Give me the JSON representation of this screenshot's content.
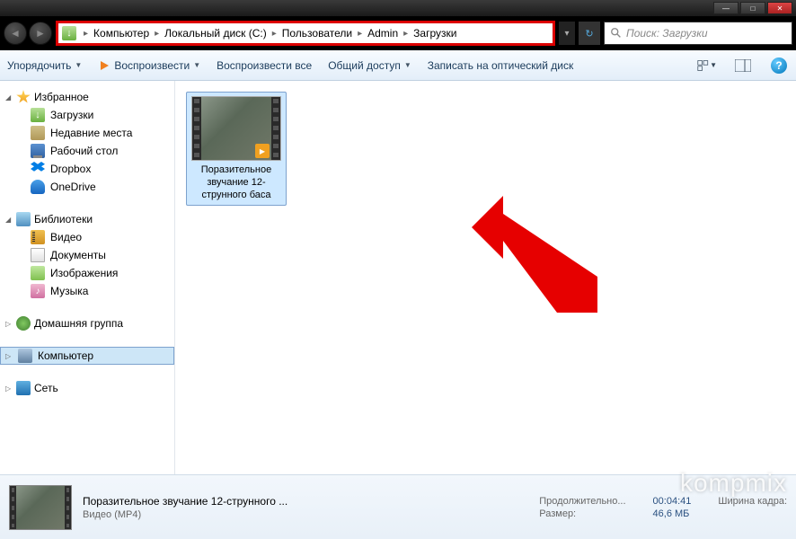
{
  "window": {
    "minimize": "—",
    "maximize": "□",
    "close": "✕"
  },
  "breadcrumbs": [
    "Компьютер",
    "Локальный диск (C:)",
    "Пользователи",
    "Admin",
    "Загрузки"
  ],
  "search": {
    "placeholder": "Поиск: Загрузки"
  },
  "toolbar": {
    "organize": "Упорядочить",
    "play": "Воспроизвести",
    "play_all": "Воспроизвести все",
    "share": "Общий доступ",
    "burn": "Записать на оптический диск"
  },
  "sidebar": {
    "favorites": {
      "label": "Избранное",
      "items": [
        {
          "icon": "ico-down",
          "label": "Загрузки"
        },
        {
          "icon": "ico-recent",
          "label": "Недавние места"
        },
        {
          "icon": "ico-desktop",
          "label": "Рабочий стол"
        },
        {
          "icon": "ico-dropbox",
          "label": "Dropbox"
        },
        {
          "icon": "ico-onedrive",
          "label": "OneDrive"
        }
      ]
    },
    "libraries": {
      "label": "Библиотеки",
      "items": [
        {
          "icon": "ico-video",
          "label": "Видео"
        },
        {
          "icon": "ico-doc",
          "label": "Документы"
        },
        {
          "icon": "ico-img",
          "label": "Изображения"
        },
        {
          "icon": "ico-music",
          "label": "Музыка"
        }
      ]
    },
    "homegroup": {
      "label": "Домашняя группа"
    },
    "computer": {
      "label": "Компьютер"
    },
    "network": {
      "label": "Сеть"
    }
  },
  "file": {
    "name": "Поразительное звучание 12-струнного баса"
  },
  "details": {
    "title": "Поразительное звучание 12-струнного ...",
    "type": "Видео (MP4)",
    "duration_label": "Продолжительно...",
    "duration": "00:04:41",
    "size_label": "Размер:",
    "size": "46,6 МБ",
    "width_label": "Ширина кадра:"
  },
  "watermark": "kompmix"
}
